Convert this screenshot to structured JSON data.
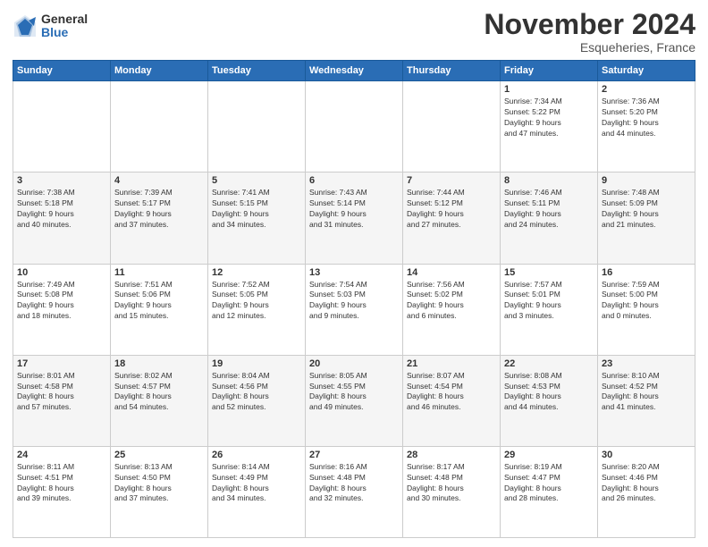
{
  "logo": {
    "general": "General",
    "blue": "Blue"
  },
  "header": {
    "month": "November 2024",
    "location": "Esqueheries, France"
  },
  "weekdays": [
    "Sunday",
    "Monday",
    "Tuesday",
    "Wednesday",
    "Thursday",
    "Friday",
    "Saturday"
  ],
  "weeks": [
    [
      {
        "day": "",
        "info": ""
      },
      {
        "day": "",
        "info": ""
      },
      {
        "day": "",
        "info": ""
      },
      {
        "day": "",
        "info": ""
      },
      {
        "day": "",
        "info": ""
      },
      {
        "day": "1",
        "info": "Sunrise: 7:34 AM\nSunset: 5:22 PM\nDaylight: 9 hours\nand 47 minutes."
      },
      {
        "day": "2",
        "info": "Sunrise: 7:36 AM\nSunset: 5:20 PM\nDaylight: 9 hours\nand 44 minutes."
      }
    ],
    [
      {
        "day": "3",
        "info": "Sunrise: 7:38 AM\nSunset: 5:18 PM\nDaylight: 9 hours\nand 40 minutes."
      },
      {
        "day": "4",
        "info": "Sunrise: 7:39 AM\nSunset: 5:17 PM\nDaylight: 9 hours\nand 37 minutes."
      },
      {
        "day": "5",
        "info": "Sunrise: 7:41 AM\nSunset: 5:15 PM\nDaylight: 9 hours\nand 34 minutes."
      },
      {
        "day": "6",
        "info": "Sunrise: 7:43 AM\nSunset: 5:14 PM\nDaylight: 9 hours\nand 31 minutes."
      },
      {
        "day": "7",
        "info": "Sunrise: 7:44 AM\nSunset: 5:12 PM\nDaylight: 9 hours\nand 27 minutes."
      },
      {
        "day": "8",
        "info": "Sunrise: 7:46 AM\nSunset: 5:11 PM\nDaylight: 9 hours\nand 24 minutes."
      },
      {
        "day": "9",
        "info": "Sunrise: 7:48 AM\nSunset: 5:09 PM\nDaylight: 9 hours\nand 21 minutes."
      }
    ],
    [
      {
        "day": "10",
        "info": "Sunrise: 7:49 AM\nSunset: 5:08 PM\nDaylight: 9 hours\nand 18 minutes."
      },
      {
        "day": "11",
        "info": "Sunrise: 7:51 AM\nSunset: 5:06 PM\nDaylight: 9 hours\nand 15 minutes."
      },
      {
        "day": "12",
        "info": "Sunrise: 7:52 AM\nSunset: 5:05 PM\nDaylight: 9 hours\nand 12 minutes."
      },
      {
        "day": "13",
        "info": "Sunrise: 7:54 AM\nSunset: 5:03 PM\nDaylight: 9 hours\nand 9 minutes."
      },
      {
        "day": "14",
        "info": "Sunrise: 7:56 AM\nSunset: 5:02 PM\nDaylight: 9 hours\nand 6 minutes."
      },
      {
        "day": "15",
        "info": "Sunrise: 7:57 AM\nSunset: 5:01 PM\nDaylight: 9 hours\nand 3 minutes."
      },
      {
        "day": "16",
        "info": "Sunrise: 7:59 AM\nSunset: 5:00 PM\nDaylight: 9 hours\nand 0 minutes."
      }
    ],
    [
      {
        "day": "17",
        "info": "Sunrise: 8:01 AM\nSunset: 4:58 PM\nDaylight: 8 hours\nand 57 minutes."
      },
      {
        "day": "18",
        "info": "Sunrise: 8:02 AM\nSunset: 4:57 PM\nDaylight: 8 hours\nand 54 minutes."
      },
      {
        "day": "19",
        "info": "Sunrise: 8:04 AM\nSunset: 4:56 PM\nDaylight: 8 hours\nand 52 minutes."
      },
      {
        "day": "20",
        "info": "Sunrise: 8:05 AM\nSunset: 4:55 PM\nDaylight: 8 hours\nand 49 minutes."
      },
      {
        "day": "21",
        "info": "Sunrise: 8:07 AM\nSunset: 4:54 PM\nDaylight: 8 hours\nand 46 minutes."
      },
      {
        "day": "22",
        "info": "Sunrise: 8:08 AM\nSunset: 4:53 PM\nDaylight: 8 hours\nand 44 minutes."
      },
      {
        "day": "23",
        "info": "Sunrise: 8:10 AM\nSunset: 4:52 PM\nDaylight: 8 hours\nand 41 minutes."
      }
    ],
    [
      {
        "day": "24",
        "info": "Sunrise: 8:11 AM\nSunset: 4:51 PM\nDaylight: 8 hours\nand 39 minutes."
      },
      {
        "day": "25",
        "info": "Sunrise: 8:13 AM\nSunset: 4:50 PM\nDaylight: 8 hours\nand 37 minutes."
      },
      {
        "day": "26",
        "info": "Sunrise: 8:14 AM\nSunset: 4:49 PM\nDaylight: 8 hours\nand 34 minutes."
      },
      {
        "day": "27",
        "info": "Sunrise: 8:16 AM\nSunset: 4:48 PM\nDaylight: 8 hours\nand 32 minutes."
      },
      {
        "day": "28",
        "info": "Sunrise: 8:17 AM\nSunset: 4:48 PM\nDaylight: 8 hours\nand 30 minutes."
      },
      {
        "day": "29",
        "info": "Sunrise: 8:19 AM\nSunset: 4:47 PM\nDaylight: 8 hours\nand 28 minutes."
      },
      {
        "day": "30",
        "info": "Sunrise: 8:20 AM\nSunset: 4:46 PM\nDaylight: 8 hours\nand 26 minutes."
      }
    ]
  ]
}
